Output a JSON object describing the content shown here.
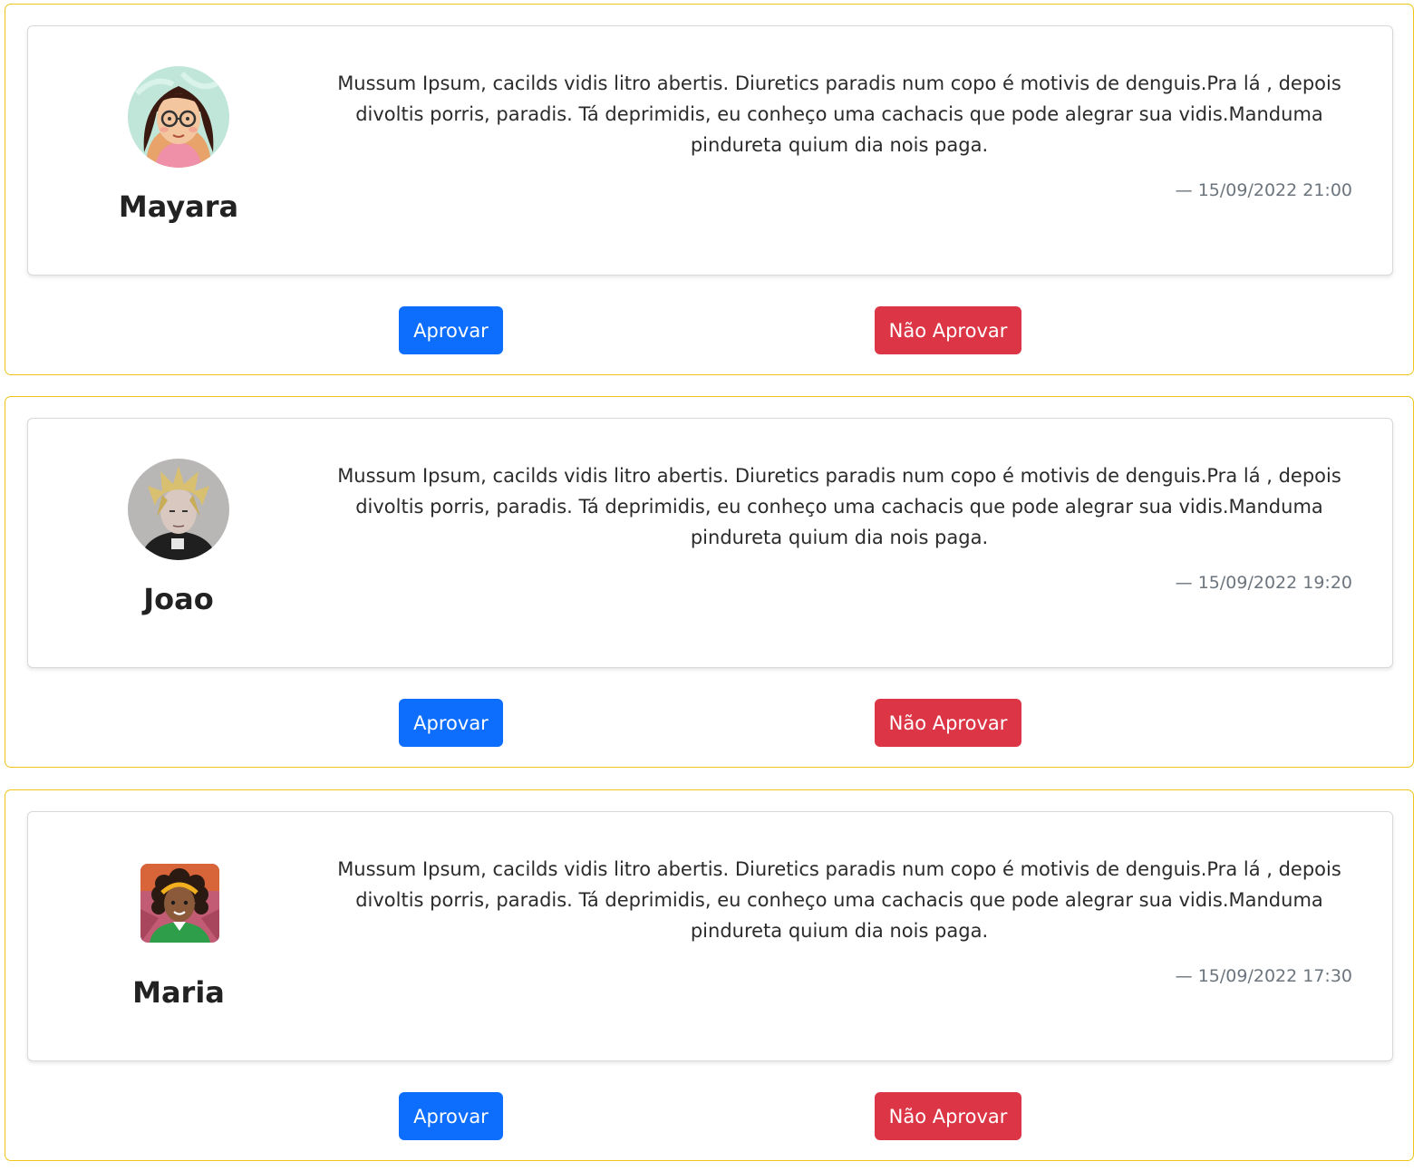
{
  "reviews": [
    {
      "name": "Mayara",
      "avatar_icon": "avatar-woman-glasses",
      "text": "Mussum Ipsum, cacilds vidis litro abertis. Diuretics paradis num copo é motivis de denguis.Pra lá , depois divoltis porris, paradis. Tá deprimidis, eu conheço uma cachacis que pode alegrar sua vidis.Manduma pindureta quium dia nois paga.",
      "date": "— 15/09/2022 21:00",
      "approve_label": "Aprovar",
      "reject_label": "Não Aprovar"
    },
    {
      "name": "Joao",
      "avatar_icon": "avatar-blond-man",
      "text": "Mussum Ipsum, cacilds vidis litro abertis. Diuretics paradis num copo é motivis de denguis.Pra lá , depois divoltis porris, paradis. Tá deprimidis, eu conheço uma cachacis que pode alegrar sua vidis.Manduma pindureta quium dia nois paga.",
      "date": "— 15/09/2022 19:20",
      "approve_label": "Aprovar",
      "reject_label": "Não Aprovar"
    },
    {
      "name": "Maria",
      "avatar_icon": "avatar-woman-curly-hair",
      "text": "Mussum Ipsum, cacilds vidis litro abertis. Diuretics paradis num copo é motivis de denguis.Pra lá , depois divoltis porris, paradis. Tá deprimidis, eu conheço uma cachacis que pode alegrar sua vidis.Manduma pindureta quium dia nois paga.",
      "date": "— 15/09/2022 17:30",
      "approve_label": "Aprovar",
      "reject_label": "Não Aprovar"
    }
  ],
  "colors": {
    "outer_border": "#f0c419",
    "approve": "#0d6efd",
    "reject": "#dc3545",
    "date_text": "#6c757d"
  }
}
